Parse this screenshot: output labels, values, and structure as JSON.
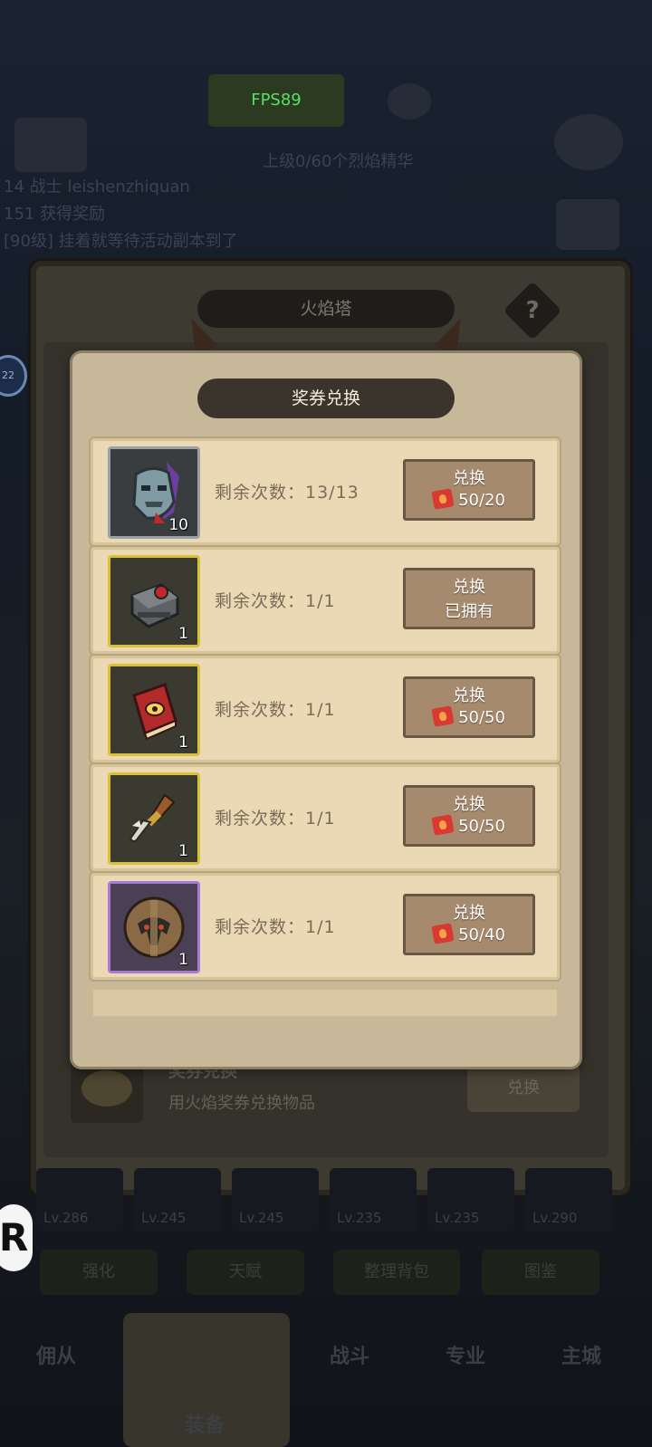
{
  "hud": {
    "fps": "FPS89",
    "bg_texts": [
      "上级0/60个烈焰精华",
      "14 战士 leishenzhiquan",
      "151 获得奖励",
      "[90级] 挂着就等待活动副本到了"
    ],
    "side_badge": "22",
    "r_badge": "R"
  },
  "fire_tower": {
    "title": "火焰塔",
    "help": "?",
    "voucher_title": "奖券兑换",
    "voucher_desc": "用火焰奖券兑换物品",
    "exchange_btn": "兑换"
  },
  "bottom": {
    "levels": [
      "Lv.286",
      "Lv.245",
      "Lv.245",
      "Lv.235",
      "Lv.235",
      "Lv.290"
    ],
    "buttons": [
      "强化",
      "天赋",
      "整理背包",
      "图鉴"
    ],
    "nav": [
      "佣从",
      "装备",
      "战斗",
      "专业",
      "主城"
    ]
  },
  "modal": {
    "title": "奖券兑换",
    "items": [
      {
        "icon": "stone-golem-head-icon",
        "frame": "gray",
        "qty": "10",
        "remaining": "剩余次数：13/13",
        "btn_label": "兑换",
        "cost": "50/20",
        "owned": false
      },
      {
        "icon": "mechanical-gauntlet-icon",
        "frame": "gold",
        "qty": "1",
        "remaining": "剩余次数：1/1",
        "btn_label": "兑换",
        "cost": "已拥有",
        "owned": true
      },
      {
        "icon": "red-eye-book-icon",
        "frame": "gold",
        "qty": "1",
        "remaining": "剩余次数：1/1",
        "btn_label": "兑换",
        "cost": "50/50",
        "owned": false
      },
      {
        "icon": "bone-dagger-icon",
        "frame": "gold",
        "qty": "1",
        "remaining": "剩余次数：1/1",
        "btn_label": "兑换",
        "cost": "50/50",
        "owned": false
      },
      {
        "icon": "gladiator-helmet-icon",
        "frame": "purple",
        "qty": "1",
        "remaining": "剩余次数：1/1",
        "btn_label": "兑换",
        "cost": "50/40",
        "owned": false
      }
    ]
  },
  "colors": {
    "modal_bg": "#c7b899",
    "row_bg": "#ead9b4",
    "button_bg": "#a68a6d",
    "ticket_red": "#d83a32",
    "fps_green": "#57e063"
  }
}
